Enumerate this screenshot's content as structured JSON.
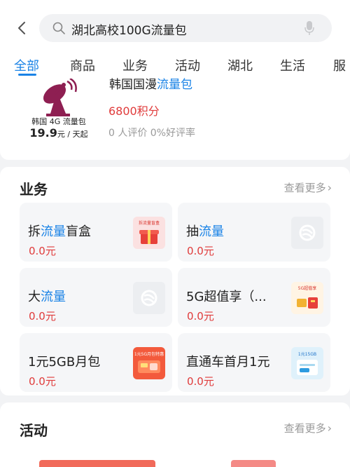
{
  "search": {
    "query": "湖北高校100G流量包"
  },
  "tabs": [
    {
      "label": "全部"
    },
    {
      "label": "商品"
    },
    {
      "label": "业务"
    },
    {
      "label": "活动"
    },
    {
      "label": "湖北"
    },
    {
      "label": "生活"
    },
    {
      "label": "服"
    }
  ],
  "product": {
    "thumb_title": "韩国 4G 流量包",
    "thumb_price": "19.9",
    "thumb_unit": "元 / 天起",
    "name_prefix": "韩国国漫",
    "name_highlight": "流量包",
    "points": "6800积分",
    "reviews": "0 人评价 0%好评率"
  },
  "business": {
    "title": "业务",
    "more": "查看更多",
    "cards": [
      {
        "pre": "拆",
        "hl": "流量",
        "post": "盲盒",
        "price": "0.0元",
        "thumb_text": "拆流量盲盒"
      },
      {
        "pre": "抽",
        "hl": "流量",
        "post": "",
        "price": "0.0元",
        "thumb_text": ""
      },
      {
        "pre": "大",
        "hl": "流量",
        "post": "",
        "price": "0.0元",
        "thumb_text": ""
      },
      {
        "pre": "5G超值享（...",
        "hl": "",
        "post": "",
        "price": "0.0元",
        "thumb_text": "5G超值享"
      },
      {
        "pre": "1元5GB月包",
        "hl": "",
        "post": "",
        "price": "0.0元",
        "thumb_text": "1元5G月包特惠"
      },
      {
        "pre": "直通车首月1元",
        "hl": "",
        "post": "",
        "price": "0.0元",
        "thumb_text": "1元15GB"
      }
    ]
  },
  "activity": {
    "title": "活动",
    "more": "查看更多"
  },
  "colors": {
    "accent": "#1a83e6",
    "price": "#e03b3b",
    "background": "#f2f3f5"
  }
}
